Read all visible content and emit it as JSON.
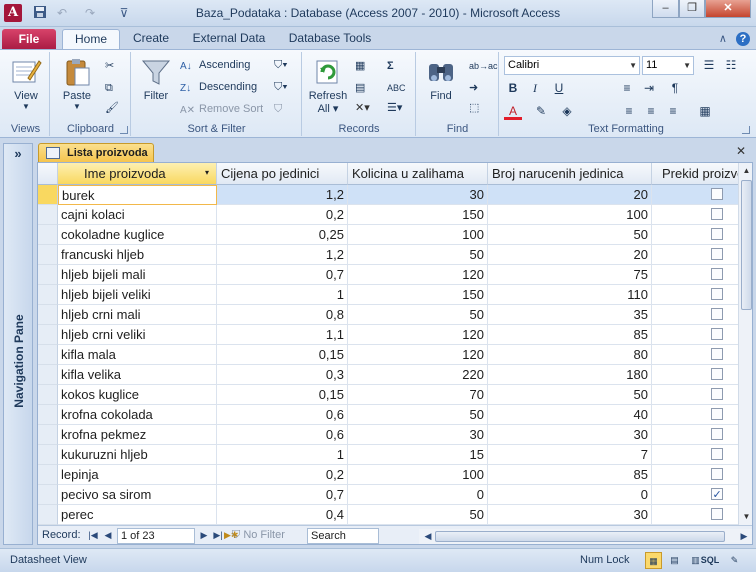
{
  "window": {
    "title": "Baza_Podataka : Database (Access 2007 - 2010)  -  Microsoft Access",
    "app_icon_letter": "A"
  },
  "ribbon_tabs": [
    "File",
    "Home",
    "Create",
    "External Data",
    "Database Tools"
  ],
  "active_tab": "Home",
  "ribbon": {
    "views": {
      "view_label": "View",
      "group_label": "Views"
    },
    "clipboard": {
      "paste_label": "Paste",
      "group_label": "Clipboard"
    },
    "sort_filter": {
      "filter_label": "Filter",
      "ascending_label": "Ascending",
      "descending_label": "Descending",
      "remove_sort_label": "Remove Sort",
      "group_label": "Sort & Filter"
    },
    "records": {
      "refresh_label": "Refresh",
      "all_label": "All",
      "group_label": "Records"
    },
    "find": {
      "find_label": "Find",
      "group_label": "Find"
    },
    "text_formatting": {
      "font_name": "Calibri",
      "font_size": "11",
      "bold": "B",
      "italic": "I",
      "underline": "U",
      "group_label": "Text Formatting"
    }
  },
  "nav_pane": {
    "label": "Navigation Pane"
  },
  "document": {
    "tab_label": "Lista proizvoda"
  },
  "table": {
    "columns": [
      "Ime proizvoda",
      "Cijena po jedinici",
      "Kolicina u zalihama",
      "Broj narucenih jedinica",
      "Prekid proizvodnje"
    ],
    "rows": [
      [
        "burek",
        "1,2",
        "30",
        "20",
        false
      ],
      [
        "cajni kolaci",
        "0,2",
        "150",
        "100",
        false
      ],
      [
        "cokoladne kuglice",
        "0,25",
        "100",
        "50",
        false
      ],
      [
        "francuski hljeb",
        "1,2",
        "50",
        "20",
        false
      ],
      [
        "hljeb bijeli mali",
        "0,7",
        "120",
        "75",
        false
      ],
      [
        "hljeb bijeli veliki",
        "1",
        "150",
        "110",
        false
      ],
      [
        "hljeb crni mali",
        "0,8",
        "50",
        "35",
        false
      ],
      [
        "hljeb crni veliki",
        "1,1",
        "120",
        "85",
        false
      ],
      [
        "kifla mala",
        "0,15",
        "120",
        "80",
        false
      ],
      [
        "kifla velika",
        "0,3",
        "220",
        "180",
        false
      ],
      [
        "kokos kuglice",
        "0,15",
        "70",
        "50",
        false
      ],
      [
        "krofna cokolada",
        "0,6",
        "50",
        "40",
        false
      ],
      [
        "krofna pekmez",
        "0,6",
        "30",
        "30",
        false
      ],
      [
        "kukuruzni hljeb",
        "1",
        "15",
        "7",
        false
      ],
      [
        "lepinja",
        "0,2",
        "100",
        "85",
        false
      ],
      [
        "pecivo sa sirom",
        "0,7",
        "0",
        "0",
        true
      ],
      [
        "perec",
        "0,4",
        "50",
        "30",
        false
      ]
    ]
  },
  "record_nav": {
    "label": "Record:",
    "position": "1 of 23",
    "no_filter_label": "No Filter",
    "search_placeholder": "Search"
  },
  "status": {
    "left_text": "Datasheet View",
    "numlock_text": "Num Lock"
  },
  "colors": {
    "accent": "#a4163a",
    "selection": "#f9d860",
    "current_row": "#cfe1f7"
  }
}
